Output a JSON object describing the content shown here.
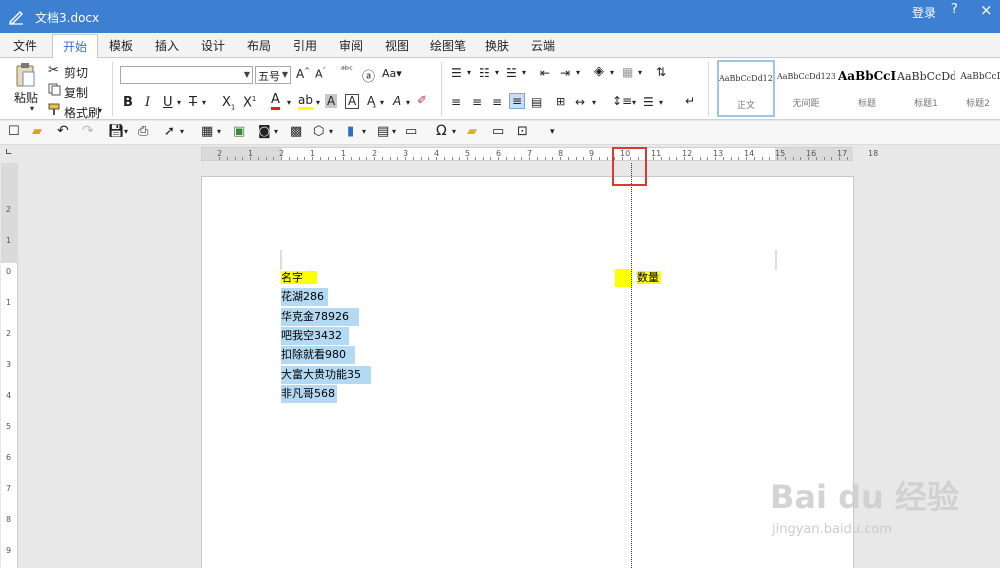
{
  "titlebar": {
    "doc_title": "文档3.docx",
    "login": "登录",
    "help": "?",
    "close": "×"
  },
  "menu": {
    "tabs": [
      {
        "label": "文件"
      },
      {
        "label": "开始"
      },
      {
        "label": "模板"
      },
      {
        "label": "插入"
      },
      {
        "label": "设计"
      },
      {
        "label": "布局"
      },
      {
        "label": "引用"
      },
      {
        "label": "审阅"
      },
      {
        "label": "视图"
      },
      {
        "label": "绘图笔"
      },
      {
        "label": "换肤"
      },
      {
        "label": "云端"
      }
    ]
  },
  "ribbon": {
    "clipboard": {
      "paste": "粘贴",
      "cut": "剪切",
      "copy": "复制",
      "format_painter": "格式刷"
    },
    "font": {
      "family_value": "",
      "size_value": "五号"
    },
    "styles": [
      {
        "sample": "AaBbCcDd123",
        "name": "正文"
      },
      {
        "sample": "AaBbCcDd123",
        "name": "无间距"
      },
      {
        "sample": "AaBbCcI",
        "name": "标题"
      },
      {
        "sample": "AaBbCcDd1",
        "name": "标题1"
      },
      {
        "sample": "AaBbCcDd",
        "name": "标题2"
      }
    ]
  },
  "ruler": {
    "h_numbers": [
      "2",
      "1",
      "2",
      "1",
      "1",
      "2",
      "3",
      "4",
      "5",
      "6",
      "7",
      "8",
      "9",
      "10",
      "11",
      "12",
      "13",
      "14",
      "15",
      "16",
      "17",
      "18"
    ],
    "v_numbers": [
      "2",
      "1",
      "0",
      "1",
      "2",
      "3",
      "4",
      "5",
      "6",
      "7",
      "8",
      "9"
    ]
  },
  "document": {
    "header_name": "名字",
    "header_qty": "数量",
    "lines": [
      "花湖286",
      "华克金78926",
      "吧我空3432",
      "扣除就看980",
      "大富大贵功能35",
      "非凡哥568"
    ]
  },
  "colors": {
    "titlebar": "#3d7fd1",
    "highlight_yellow": "#ffff00",
    "selection_blue": "#b4daf3",
    "annotation_red": "#d53b30"
  },
  "watermark": {
    "logo": "Bai du 经验",
    "url": "jingyan.baidu.com"
  }
}
